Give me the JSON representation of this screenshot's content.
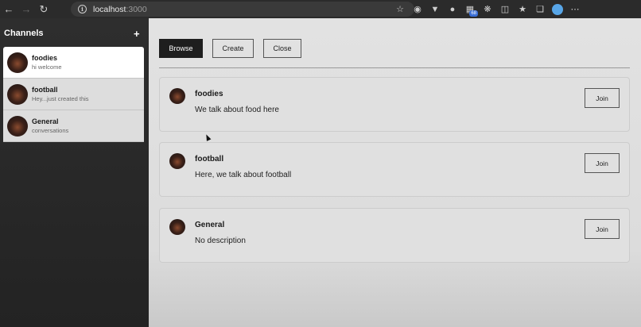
{
  "browser": {
    "url_host": "localhost",
    "url_port": ":3000",
    "extension_badge": "68"
  },
  "sidebar": {
    "title": "Channels",
    "add_label": "+",
    "channels": [
      {
        "name": "foodies",
        "preview": "hi welcome"
      },
      {
        "name": "football",
        "preview": "Hey...just created this"
      },
      {
        "name": "General",
        "preview": "conversations"
      }
    ]
  },
  "main": {
    "tabs": {
      "browse": "Browse",
      "create": "Create",
      "close": "Close"
    },
    "cards": [
      {
        "name": "foodies",
        "description": "We talk about food here",
        "join": "Join"
      },
      {
        "name": "football",
        "description": "Here, we talk about football",
        "join": "Join"
      },
      {
        "name": "General",
        "description": "No description",
        "join": "Join"
      }
    ]
  }
}
